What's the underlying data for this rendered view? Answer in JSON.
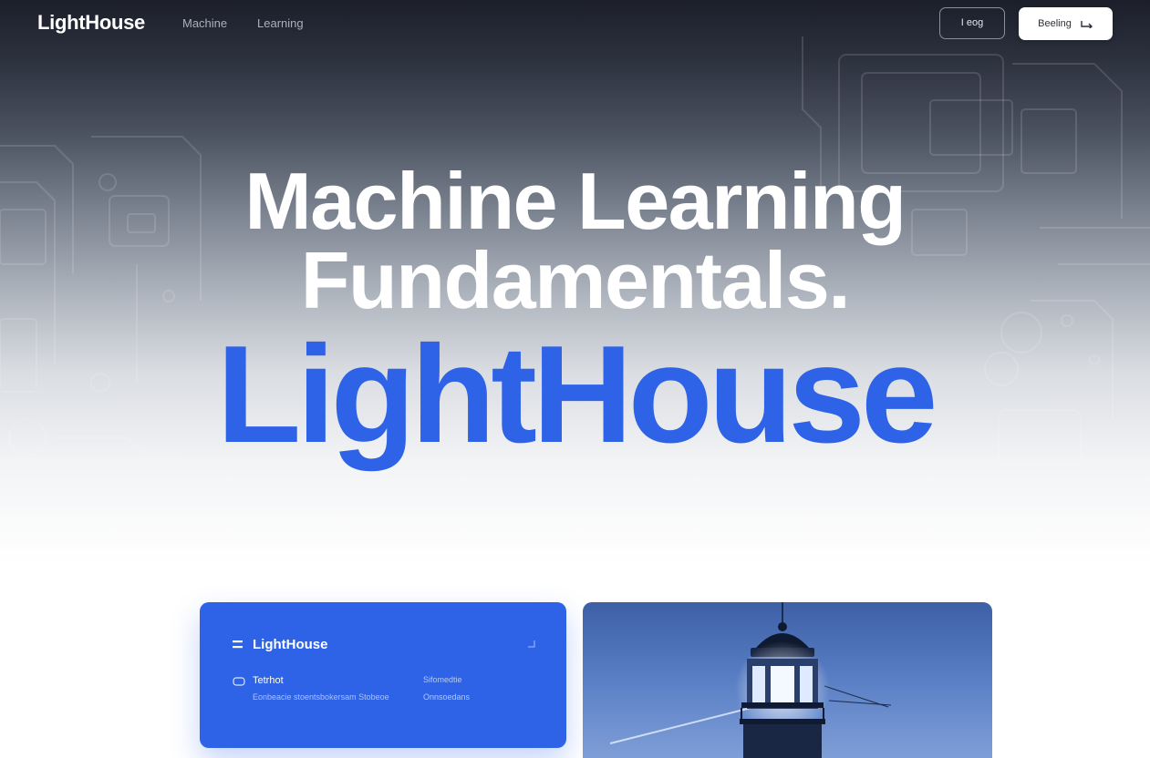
{
  "nav": {
    "logo": "LightHouse",
    "links": [
      "Machine",
      "Learning"
    ],
    "outline_button": "I eog",
    "solid_button": "Beeling",
    "solid_button_icon": "arrow-icon"
  },
  "hero": {
    "line1": "Machine Learning",
    "line2": "Fundamentals.",
    "brand": "LightHouse"
  },
  "card": {
    "title": "LightHouse",
    "section_title": "Tetrhot",
    "section_desc": "Eonbeacie stoentsbokersam Stobeoe",
    "meta": [
      "Sifomedtie",
      "Onnsoedans"
    ]
  },
  "colors": {
    "accent": "#2e63e8",
    "hero_dark": "#1c1f2a",
    "white": "#ffffff"
  }
}
